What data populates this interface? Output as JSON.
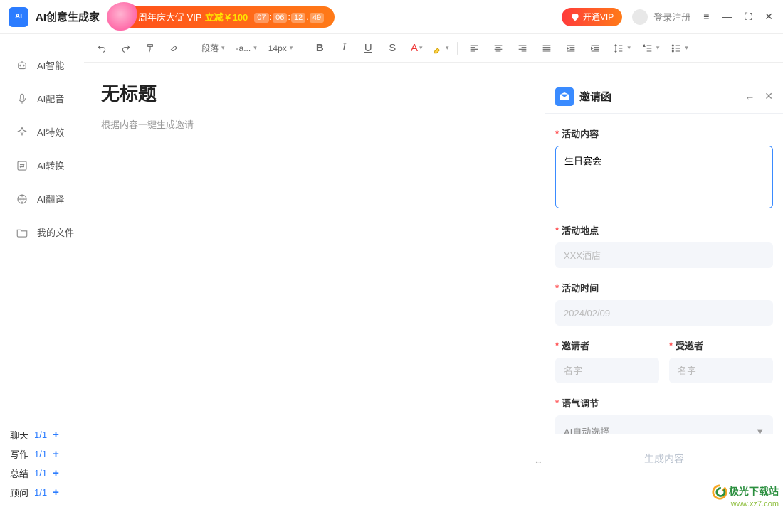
{
  "header": {
    "app_name": "AI创意生成家",
    "logo_text": "AI",
    "promo_main": "周年庆大促 VIP",
    "promo_discount": "立减￥100",
    "timer": {
      "h": "07",
      "m": "06",
      "s": "12",
      "cs": "49"
    },
    "vip_label": "开通VIP",
    "login_label": "登录注册"
  },
  "sidebar": {
    "items": [
      {
        "label": "AI智能"
      },
      {
        "label": "AI配音"
      },
      {
        "label": "AI特效"
      },
      {
        "label": "AI转换"
      },
      {
        "label": "AI翻译"
      },
      {
        "label": "我的文件"
      }
    ],
    "footer": [
      {
        "label": "聊天",
        "count": "1/1"
      },
      {
        "label": "写作",
        "count": "1/1"
      },
      {
        "label": "总结",
        "count": "1/1"
      },
      {
        "label": "顾问",
        "count": "1/1"
      }
    ]
  },
  "toolbar": {
    "para": "段落",
    "font": "-a...",
    "size": "14px"
  },
  "document": {
    "title": "无标题",
    "subtitle": "根据内容一键生成邀请"
  },
  "panel": {
    "title": "邀请函",
    "fields": {
      "content_label": "活动内容",
      "content_value": "生日宴会",
      "location_label": "活动地点",
      "location_placeholder": "XXX酒店",
      "time_label": "活动时间",
      "time_placeholder": "2024/02/09",
      "inviter_label": "邀请者",
      "inviter_placeholder": "名字",
      "invitee_label": "受邀者",
      "invitee_placeholder": "名字",
      "tone_label": "语气调节",
      "tone_value": "AI自动选择"
    },
    "generate_label": "生成内容"
  },
  "watermark": {
    "line1": "极光下载站",
    "line2": "www.xz7.com"
  }
}
